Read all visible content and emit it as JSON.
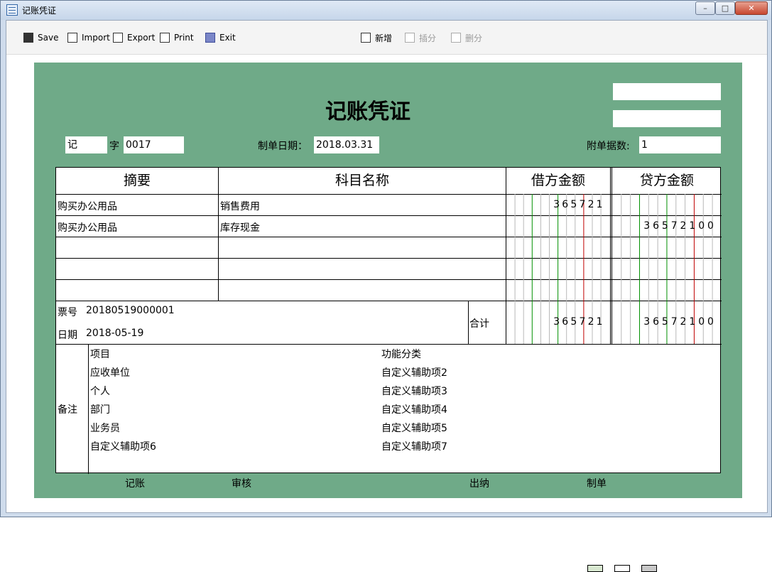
{
  "window": {
    "title": "记账凭证",
    "min_symbol": "–",
    "max_symbol": "□",
    "close_symbol": "✕"
  },
  "toolbar": {
    "save": "Save",
    "import": "Import",
    "export": "Export",
    "print": "Print",
    "exit": "Exit",
    "new": "新增",
    "insert": "插分",
    "delete": "删分"
  },
  "voucher": {
    "title": "记账凭证",
    "type": "记",
    "word_label": "字",
    "number": "0017",
    "date_label": "制单日期：",
    "date": "2018.03.31",
    "attachments_label": "附单据数:",
    "attachments": "1",
    "top_box1": "",
    "top_box2": ""
  },
  "columns": {
    "summary": "摘要",
    "account": "科目名称",
    "debit": "借方金额",
    "credit": "贷方金额"
  },
  "rows": [
    {
      "summary": "购买办公用品",
      "account": "销售费用",
      "debit": "365721",
      "credit": ""
    },
    {
      "summary": "购买办公用品",
      "account": "库存现金",
      "debit": "",
      "credit": "36572100"
    },
    {
      "summary": "",
      "account": "",
      "debit": "",
      "credit": ""
    },
    {
      "summary": "",
      "account": "",
      "debit": "",
      "credit": ""
    },
    {
      "summary": "",
      "account": "",
      "debit": "",
      "credit": ""
    }
  ],
  "footer": {
    "ticket_label": "票号",
    "ticket_no": "20180519000001",
    "date_label": "日期",
    "date": "2018-05-19",
    "total_label": "合计",
    "total_debit": "365721",
    "total_credit": "36572100"
  },
  "notes": {
    "label": "备注",
    "left": [
      "项目",
      "应收单位",
      "个人",
      "部门",
      "业务员",
      "自定义辅助项6"
    ],
    "right": [
      "功能分类",
      "自定义辅助项2",
      "自定义辅助项3",
      "自定义辅助项4",
      "自定义辅助项5",
      "自定义辅助项7"
    ]
  },
  "signatures": {
    "bookkeeping": "记账",
    "review": "审核",
    "cashier": "出纳",
    "preparer": "制单"
  }
}
